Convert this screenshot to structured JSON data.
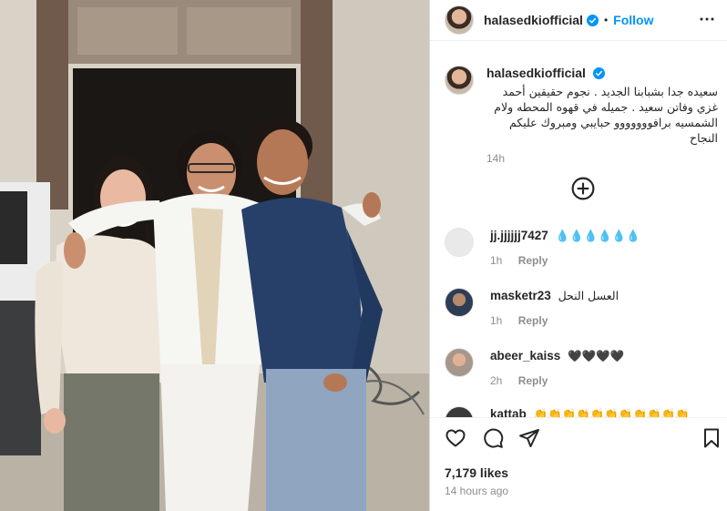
{
  "post": {
    "username": "halasedkiofficial",
    "separator": "•",
    "follow_label": "Follow"
  },
  "caption": {
    "username": "halasedkiofficial",
    "text": "سعيده جدا بشبابنا الجديد . نجوم حقيقين أحمد غزي وفاتن سعيد . جميله في قهوه المحطه ولام الشمسيه برافووووووو حبايبي ومبروك عليكم النجاح",
    "time": "14h"
  },
  "comments": [
    {
      "username": "jj.jjjjjj7427",
      "text": "💧💧💧💧💧💧",
      "time": "1h",
      "reply_label": "Reply"
    },
    {
      "username": "masketr23",
      "text": "العسل النحل",
      "time": "1h",
      "reply_label": "Reply"
    },
    {
      "username": "abeer_kaiss",
      "text": "🖤🖤🖤🖤",
      "time": "2h",
      "reply_label": "Reply"
    },
    {
      "username": "kattab",
      "text": "👏👏👏👏👏👏👏👏👏👏👏",
      "time": "",
      "reply_label": ""
    }
  ],
  "engagement": {
    "likes": "7,179 likes",
    "posted": "14 hours ago"
  },
  "icons": {
    "header": [
      "verified-icon",
      "more-options-icon"
    ],
    "actions": [
      "heart-icon",
      "comment-icon",
      "share-icon",
      "bookmark-icon"
    ],
    "load_more": "plus-circle-icon"
  },
  "colors": {
    "accent": "#0095f6",
    "text": "#262626",
    "muted": "#8e8e8e",
    "border": "#dbdbdb"
  }
}
